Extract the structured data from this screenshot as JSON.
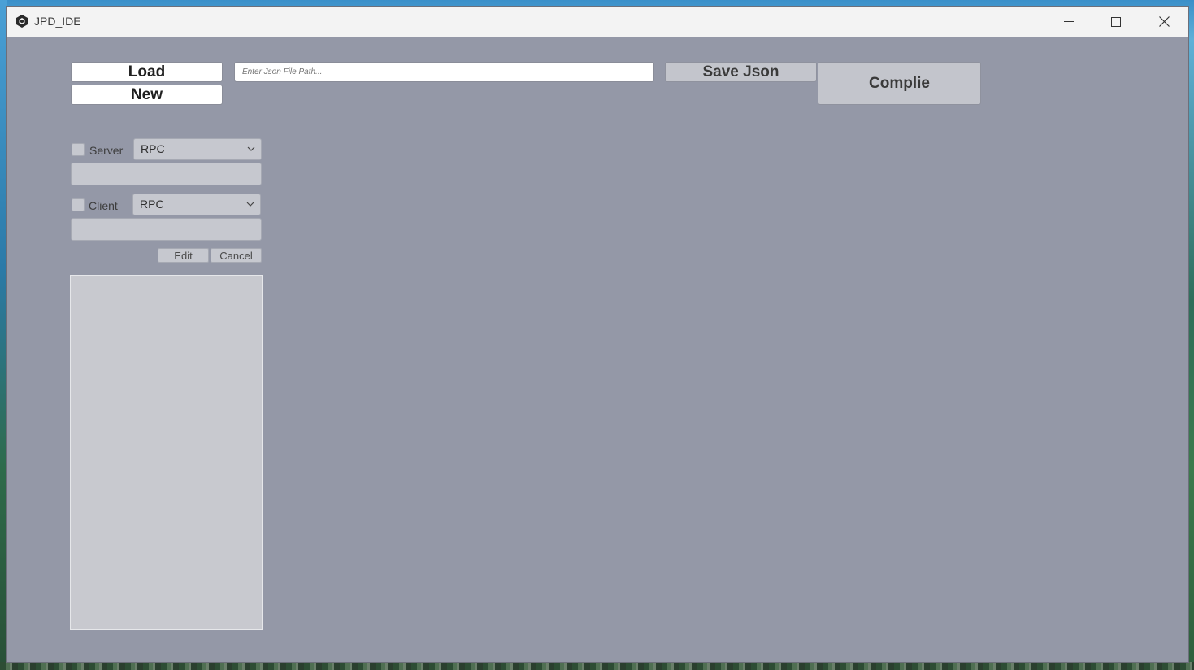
{
  "window": {
    "title": "JPD_IDE",
    "controls": {
      "minimize": "minimize-icon",
      "maximize": "maximize-icon",
      "close": "close-icon"
    }
  },
  "toolbar": {
    "load_label": "Load",
    "new_label": "New",
    "path_placeholder": "Enter Json File Path...",
    "save_label": "Save Json",
    "compile_label": "Complie"
  },
  "server": {
    "label": "Server",
    "checked": false,
    "protocol": "RPC",
    "value": ""
  },
  "client": {
    "label": "Client",
    "checked": false,
    "protocol": "RPC",
    "value": ""
  },
  "actions": {
    "edit_label": "Edit",
    "cancel_label": "Cancel"
  },
  "colors": {
    "window_bg": "#9498a7",
    "titlebar_bg": "#f3f3f3",
    "control_bg": "#c6c8cf"
  }
}
